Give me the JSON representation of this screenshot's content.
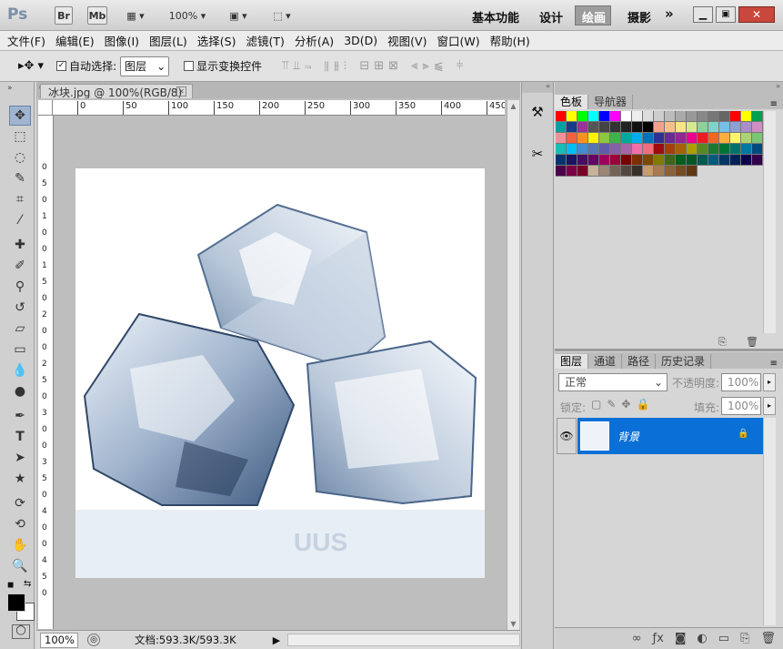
{
  "app": {
    "logo": "Ps",
    "bridge": "Br",
    "minibridge": "Mb",
    "zoom": "100%",
    "workspaces": [
      "基本功能",
      "设计",
      "绘画",
      "摄影"
    ],
    "active_workspace": "绘画",
    "more": "»"
  },
  "menu": [
    "文件(F)",
    "编辑(E)",
    "图像(I)",
    "图层(L)",
    "选择(S)",
    "滤镜(T)",
    "分析(A)",
    "3D(D)",
    "视图(V)",
    "窗口(W)",
    "帮助(H)"
  ],
  "options": {
    "auto_select_label": "自动选择:",
    "auto_select_checked": true,
    "auto_select_value": "图层",
    "transform_label": "显示变换控件",
    "transform_checked": false
  },
  "document": {
    "tab_title": "冰块.jpg @ 100%(RGB/8)",
    "ruler_top": [
      "0",
      "50",
      "100",
      "150",
      "200",
      "250",
      "300",
      "350",
      "400",
      "450"
    ],
    "ruler_left": [
      "0",
      "5",
      "0",
      "1",
      "0",
      "0",
      "1",
      "5",
      "0",
      "2",
      "0",
      "0",
      "2",
      "5",
      "0",
      "3",
      "0",
      "0",
      "3",
      "5",
      "0",
      "4",
      "0",
      "0",
      "4",
      "5",
      "0"
    ],
    "image_alt_text": "UUS"
  },
  "status": {
    "zoom": "100%",
    "doc_info": "文档:593.3K/593.3K"
  },
  "colors": {
    "accent": "#0a6fd6",
    "canvas_bg": "#bebebe"
  },
  "swatch_panel": {
    "tabs": [
      "色板",
      "导航器"
    ],
    "active": "色板",
    "swatches": [
      "#ff0000",
      "#ffff00",
      "#00ff00",
      "#00ffff",
      "#0000ff",
      "#ff00ff",
      "#ffffff",
      "#eeeeee",
      "#dddddd",
      "#cccccc",
      "#bbbbbb",
      "#aaaaaa",
      "#999999",
      "#888888",
      "#777777",
      "#666666",
      "#ff0000",
      "#ffff00",
      "#00a050",
      "#00a0a0",
      "#1a3a8a",
      "#993399",
      "#555555",
      "#444444",
      "#333333",
      "#222222",
      "#111111",
      "#000000",
      "#f2a28c",
      "#f7c08b",
      "#fbe38a",
      "#d6e98f",
      "#8fcf9a",
      "#7fd3c8",
      "#77bfe6",
      "#8d9fd3",
      "#a98dc7",
      "#cf8fc3",
      "#f2909a",
      "#f1603f",
      "#f7931d",
      "#fff200",
      "#8dc63f",
      "#39b54a",
      "#00a99d",
      "#00aeef",
      "#0072bc",
      "#2e3192",
      "#662d91",
      "#92278f",
      "#ec008c",
      "#ed1c24",
      "#f26522",
      "#fbaf3f",
      "#fff568",
      "#acd373",
      "#7cc576",
      "#1cbbb4",
      "#00bff3",
      "#448ccb",
      "#5674b9",
      "#605ca8",
      "#855fa8",
      "#a864a8",
      "#f06eaa",
      "#f26d7d",
      "#9e0b0f",
      "#a0410d",
      "#a36209",
      "#aba000",
      "#598527",
      "#197b30",
      "#007236",
      "#00746b",
      "#0076a3",
      "#004a80",
      "#003471",
      "#1b1464",
      "#440e62",
      "#630460",
      "#9e005d",
      "#9e0039",
      "#790000",
      "#7b2e00",
      "#7d4900",
      "#827b00",
      "#406618",
      "#005e20",
      "#005826",
      "#005952",
      "#005b7f",
      "#003663",
      "#002157",
      "#0d004c",
      "#32004b",
      "#4b0049",
      "#7b0046",
      "#7a0026",
      "#c7b299",
      "#998675",
      "#736357",
      "#534741",
      "#37302a",
      "#c69c6d",
      "#a67c52",
      "#8c6239",
      "#754c24",
      "#603913"
    ]
  },
  "layers_panel": {
    "tabs": [
      "图层",
      "通道",
      "路径",
      "历史记录"
    ],
    "active": "图层",
    "blend_mode": "正常",
    "opacity_label": "不透明度:",
    "opacity": "100%",
    "lock_label": "锁定:",
    "fill_label": "填充:",
    "fill": "100%",
    "layer_name": "背景"
  }
}
